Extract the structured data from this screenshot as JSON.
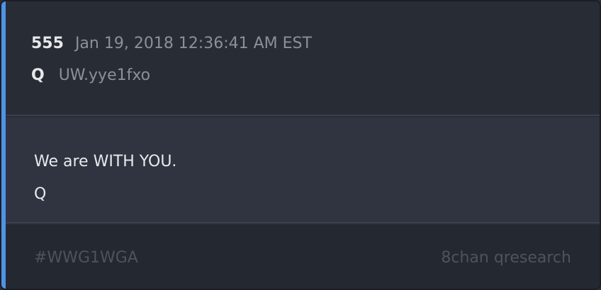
{
  "post": {
    "number": "555",
    "timestamp": "Jan 19, 2018 12:36:41 AM EST",
    "author": "Q",
    "tripcode": "UW.yye1fxo",
    "body_lines": [
      "We are WITH YOU.",
      "Q"
    ],
    "hashtag": "#WWG1WGA",
    "source": "8chan qresearch"
  },
  "colors": {
    "accent": "#4f93e6",
    "background": "#2a2e37",
    "body_background": "#2f3440",
    "footer_background": "#242830",
    "muted_text": "#8b9099"
  }
}
